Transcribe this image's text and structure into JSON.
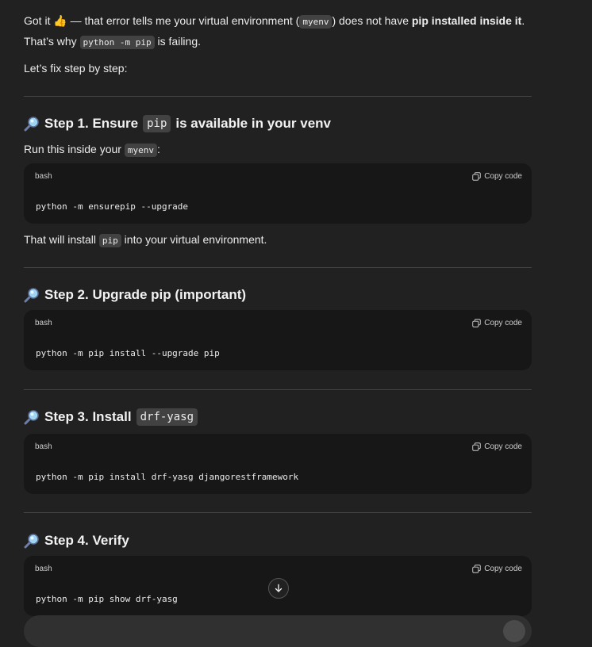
{
  "intro": {
    "part1": "Got it ",
    "emoji": "👍",
    "part2": " — that error tells me your virtual environment (",
    "venv": "myenv",
    "part3": ") does not have ",
    "bold": "pip installed inside it",
    "part4": ". That’s why ",
    "cmd": "python -m pip",
    "part5": " is failing."
  },
  "lets_fix": "Let’s fix step by step:",
  "steps": [
    {
      "title_prefix": "Step 1. Ensure ",
      "title_code": "pip",
      "title_suffix": " is available in your venv",
      "pre_text": "Run this inside your ",
      "pre_code": "myenv",
      "pre_after": ":",
      "lang": "bash",
      "copy_label": "Copy code",
      "code": "python -m ensurepip --upgrade",
      "post_text": "That will install ",
      "post_code": "pip",
      "post_after": " into your virtual environment."
    },
    {
      "title": "Step 2. Upgrade pip (important)",
      "lang": "bash",
      "copy_label": "Copy code",
      "code": "python -m pip install --upgrade pip"
    },
    {
      "title_prefix": "Step 3. Install ",
      "title_code": "drf-yasg",
      "lang": "bash",
      "copy_label": "Copy code",
      "code": "python -m pip install drf-yasg djangorestframework"
    },
    {
      "title": "Step 4. Verify",
      "lang": "bash",
      "copy_label": "Copy code",
      "code": "python -m pip show drf-yasg"
    }
  ],
  "icons": {
    "step_icon": "magnifier-icon",
    "copy_icon": "copy-icon",
    "scroll_icon": "arrow-down-icon"
  }
}
